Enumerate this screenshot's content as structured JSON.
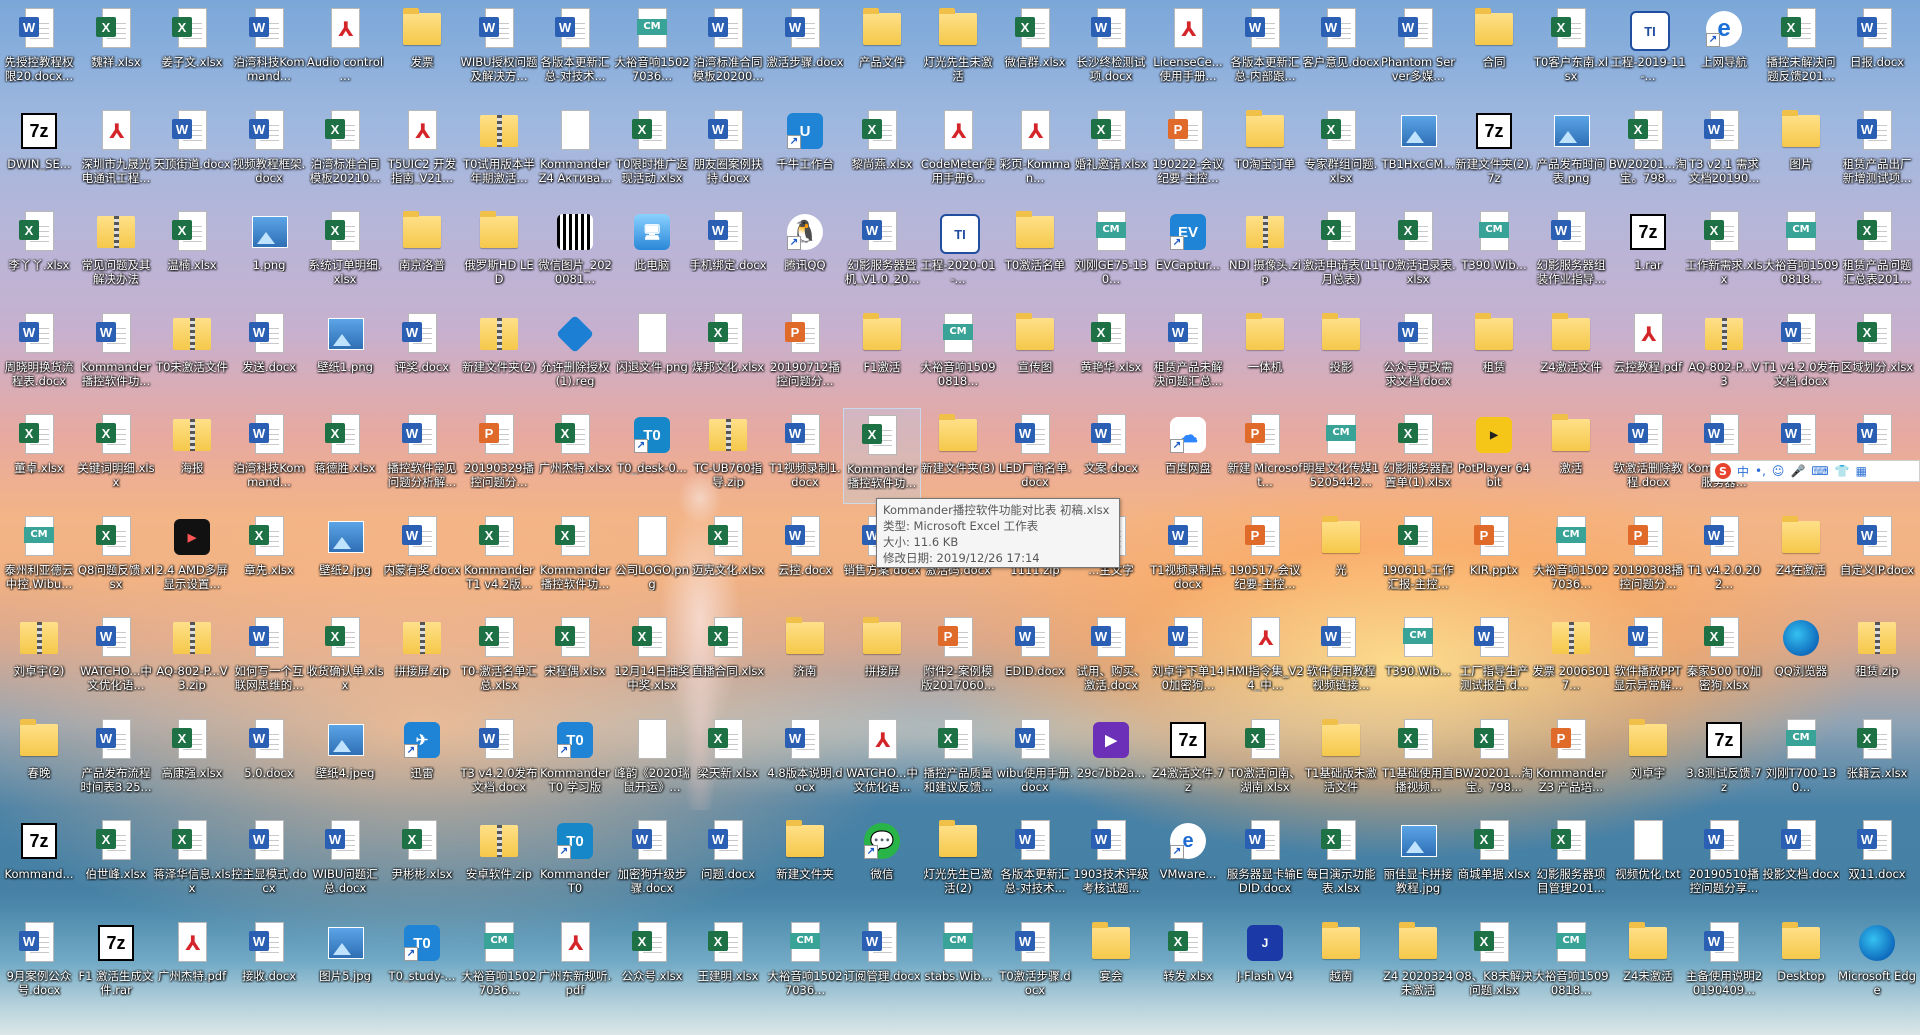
{
  "desktop": {
    "columns": 25,
    "selected_label": "Kommander播控软件功能对比表 初稿.xlsx",
    "icons": [
      {
        "label": "先授控教程权限20.docx...",
        "type": "word"
      },
      {
        "label": "魏祥.xlsx",
        "type": "excel"
      },
      {
        "label": "姜子文.xlsx",
        "type": "excel"
      },
      {
        "label": "泊湾科技Kommand...",
        "type": "word"
      },
      {
        "label": "Audio control ...",
        "type": "pdf"
      },
      {
        "label": "发票",
        "type": "folder"
      },
      {
        "label": "WIBU授权问题及解决方...",
        "type": "word"
      },
      {
        "label": "各版本更新汇总-对技术...",
        "type": "word"
      },
      {
        "label": "大裕音响15027036...",
        "type": "cm"
      },
      {
        "label": "泊湾标准合同模板20200...",
        "type": "word"
      },
      {
        "label": "激活步骤.docx",
        "type": "word"
      },
      {
        "label": "产品文件",
        "type": "folder"
      },
      {
        "label": "灯光先生未激活",
        "type": "folder"
      },
      {
        "label": "微信群.xlsx",
        "type": "excel"
      },
      {
        "label": "长沙终检测试项.docx",
        "type": "word"
      },
      {
        "label": "LicenseCe...使用手册...",
        "type": "pdf"
      },
      {
        "label": "各版本更新汇总-内部跟...",
        "type": "word"
      },
      {
        "label": "客户意见.docx",
        "type": "word"
      },
      {
        "label": "Phantom Server多媒...",
        "type": "word"
      },
      {
        "label": "合同",
        "type": "folder"
      },
      {
        "label": "T0客户东南.xlsx",
        "type": "excel"
      },
      {
        "label": "工程-2019-11-...",
        "type": "ti"
      },
      {
        "label": "上网导航",
        "type": "ie"
      },
      {
        "label": "播控未解决问题反馈201...",
        "type": "excel"
      },
      {
        "label": "日报.docx",
        "type": "word"
      },
      {
        "label": "DWIN_SE...",
        "type": "7z"
      },
      {
        "label": "深圳市九晟光电通讯工程...",
        "type": "pdf"
      },
      {
        "label": "天顶街道.docx",
        "type": "word"
      },
      {
        "label": "视频教程框架.docx",
        "type": "word"
      },
      {
        "label": "泊湾标准合同模板20210...",
        "type": "excel"
      },
      {
        "label": "T5UIC2 开发指南_V21...",
        "type": "pdf"
      },
      {
        "label": "T0试用版本半年期激活...",
        "type": "zip"
      },
      {
        "label": "Kommander Z4 Активa...",
        "type": "blank"
      },
      {
        "label": "T0限时推广返现活动.xlsx",
        "type": "excel"
      },
      {
        "label": "朋友圈案例扶持.docx",
        "type": "word"
      },
      {
        "label": "千牛工作台",
        "type": "app-blue",
        "glyph": "U"
      },
      {
        "label": "黎尚燕.xlsx",
        "type": "excel"
      },
      {
        "label": "CodeMeter使用手册6...",
        "type": "pdf"
      },
      {
        "label": "彩页-Komman...",
        "type": "pdf"
      },
      {
        "label": "婚礼邀请.xlsx",
        "type": "excel"
      },
      {
        "label": "190222-会议纪要-主控...",
        "type": "wps"
      },
      {
        "label": "T0淘宝订单",
        "type": "folder"
      },
      {
        "label": "专家群组问题.xlsx",
        "type": "excel"
      },
      {
        "label": "TB1HxcCM...",
        "type": "img"
      },
      {
        "label": "新建文件夹(2).7z",
        "type": "7z"
      },
      {
        "label": "产品发布时间表.png",
        "type": "img"
      },
      {
        "label": "BW20201...淘宝。798...",
        "type": "excel"
      },
      {
        "label": "T3 v2.1 需求文档20190...",
        "type": "word"
      },
      {
        "label": "图片",
        "type": "folder"
      },
      {
        "label": "租赁产品出厂新增测试项...",
        "type": "word"
      },
      {
        "label": "李丫丫.xlsx",
        "type": "excel"
      },
      {
        "label": "常见问题及其解决办法",
        "type": "zip"
      },
      {
        "label": "温楠.xlsx",
        "type": "excel"
      },
      {
        "label": "1.png",
        "type": "img"
      },
      {
        "label": "系统订单明细.xlsx",
        "type": "excel"
      },
      {
        "label": "南京洛普",
        "type": "folder"
      },
      {
        "label": "俄罗斯HD LED",
        "type": "folder"
      },
      {
        "label": "微信图片_2020081...",
        "type": "qr"
      },
      {
        "label": "此电脑",
        "type": "pc"
      },
      {
        "label": "手机绑定.docx",
        "type": "word"
      },
      {
        "label": "腾讯QQ",
        "type": "qq"
      },
      {
        "label": "幻影服务器暨机_V1.0_20...",
        "type": "word"
      },
      {
        "label": "工程-2020-01-...",
        "type": "ti"
      },
      {
        "label": "T0激活名单",
        "type": "folder"
      },
      {
        "label": "刘刚GE75-130...",
        "type": "cm"
      },
      {
        "label": "EVCaptur...",
        "type": "app-blue",
        "glyph": "EV"
      },
      {
        "label": "NDI 摄像头.zip",
        "type": "zip"
      },
      {
        "label": "激活申请表(11月总表)",
        "type": "excel"
      },
      {
        "label": "T0激活记录表.xlsx",
        "type": "excel"
      },
      {
        "label": "T390.Wib...",
        "type": "cm"
      },
      {
        "label": "幻影服务器组装作业指导...",
        "type": "word"
      },
      {
        "label": "1.rar",
        "type": "7z"
      },
      {
        "label": "工作新需求.xlsx",
        "type": "excel"
      },
      {
        "label": "大裕音响15090818...",
        "type": "cm"
      },
      {
        "label": "租赁产品问题汇总表201...",
        "type": "excel"
      },
      {
        "label": "周晓明换货流程表.docx",
        "type": "word"
      },
      {
        "label": "Kommander 播控软件功...",
        "type": "word"
      },
      {
        "label": "T0未激活文件",
        "type": "zip"
      },
      {
        "label": "发送.docx",
        "type": "word"
      },
      {
        "label": "壁纸1.png",
        "type": "img"
      },
      {
        "label": "评奖.docx",
        "type": "word"
      },
      {
        "label": "新建文件夹(2)",
        "type": "zip"
      },
      {
        "label": "允许删除授权(1).reg",
        "type": "reg"
      },
      {
        "label": "闪退文件.png",
        "type": "blank"
      },
      {
        "label": "煤邦文化.xlsx",
        "type": "excel"
      },
      {
        "label": "20190712播控问题分...",
        "type": "wps"
      },
      {
        "label": "F1激活",
        "type": "folder"
      },
      {
        "label": "大裕音响15090818...",
        "type": "cm"
      },
      {
        "label": "宣传图",
        "type": "folder"
      },
      {
        "label": "黄艳华.xlsx",
        "type": "excel"
      },
      {
        "label": "租赁产品未解决问题汇总...",
        "type": "word"
      },
      {
        "label": "一体机",
        "type": "folder"
      },
      {
        "label": "投影",
        "type": "folder"
      },
      {
        "label": "公众号更改需求文档.docx",
        "type": "word"
      },
      {
        "label": "租赁",
        "type": "folder"
      },
      {
        "label": "Z4激活文件",
        "type": "folder"
      },
      {
        "label": "云控教程.pdf",
        "type": "pdf"
      },
      {
        "label": "AQ-802-P...V3",
        "type": "zip"
      },
      {
        "label": "T1 v4.2.0发布文档.docx",
        "type": "word"
      },
      {
        "label": "区域划分.xlsx",
        "type": "excel"
      },
      {
        "label": "董卓.xlsx",
        "type": "excel"
      },
      {
        "label": "关键词明细.xlsx",
        "type": "excel"
      },
      {
        "label": "海报",
        "type": "zip"
      },
      {
        "label": "泊湾科技Kommand...",
        "type": "word"
      },
      {
        "label": "蒋德胜.xlsx",
        "type": "excel"
      },
      {
        "label": "播控软件常见问题分析解...",
        "type": "word"
      },
      {
        "label": "20190329播控问题分...",
        "type": "wps"
      },
      {
        "label": "广州杰特.xlsx",
        "type": "excel"
      },
      {
        "label": "T0_desk-0...",
        "type": "app-teal",
        "glyph": "T0"
      },
      {
        "label": "TC-UB760指导.zip",
        "type": "zip"
      },
      {
        "label": "T1视频录制1.docx",
        "type": "word"
      },
      {
        "label": "Kommander播控软件功...",
        "type": "excel",
        "selected": true
      },
      {
        "label": "新建文件夹(3)",
        "type": "folder"
      },
      {
        "label": "LED厂商名单.docx",
        "type": "word"
      },
      {
        "label": "文案.docx",
        "type": "word"
      },
      {
        "label": "百度网盘",
        "type": "baidu"
      },
      {
        "label": "新建 Microsoft...",
        "type": "wps"
      },
      {
        "label": "明星文化传媒15205442...",
        "type": "cm"
      },
      {
        "label": "幻影服务器配置单(1).xlsx",
        "type": "excel"
      },
      {
        "label": "PotPlayer 64 bit",
        "type": "pot"
      },
      {
        "label": "激活",
        "type": "folder"
      },
      {
        "label": "软激活删除教程.docx",
        "type": "word"
      },
      {
        "label": "Komma... Z4服务器...",
        "type": "word"
      },
      {
        "label": ".docx",
        "type": "word"
      },
      {
        "label": ".docx",
        "type": "word"
      },
      {
        "label": "泰州利亚德云中控.Wibu...",
        "type": "cm"
      },
      {
        "label": "Q8问题反馈.xlsx",
        "type": "excel"
      },
      {
        "label": "2.4 AMD多屏显示设置...",
        "type": "black"
      },
      {
        "label": "章先.xlsx",
        "type": "excel"
      },
      {
        "label": "壁纸2.jpg",
        "type": "img"
      },
      {
        "label": "内蒙有奖.docx",
        "type": "word"
      },
      {
        "label": "Kommander T1 v4.2版...",
        "type": "excel"
      },
      {
        "label": "Kommander 播控软件功...",
        "type": "excel"
      },
      {
        "label": "公司LOGO.png",
        "type": "blank"
      },
      {
        "label": "迈克文化.xlsx",
        "type": "excel"
      },
      {
        "label": "云控.docx",
        "type": "word"
      },
      {
        "label": "销售方案.docx",
        "type": "word"
      },
      {
        "label": "激活码.docx",
        "type": "word"
      },
      {
        "label": "1111.zip",
        "type": "zip"
      },
      {
        "label": "...主文字",
        "type": "word"
      },
      {
        "label": "T1视频录制点.docx",
        "type": "word"
      },
      {
        "label": "190517-会议纪要-主控...",
        "type": "wps"
      },
      {
        "label": "光",
        "type": "folder"
      },
      {
        "label": "190611-工作汇报-主控...",
        "type": "excel"
      },
      {
        "label": "KIR.pptx",
        "type": "wps"
      },
      {
        "label": "大裕音响15027036...",
        "type": "cm"
      },
      {
        "label": "20190308播控问题分...",
        "type": "wps"
      },
      {
        "label": "T1 v4.2.0.202...",
        "type": "word"
      },
      {
        "label": "Z4在激活",
        "type": "folder"
      },
      {
        "label": "自定义IP.docx",
        "type": "word"
      },
      {
        "label": "刘卓宇(2)",
        "type": "zip"
      },
      {
        "label": "WATCHO...中文优化语...",
        "type": "word"
      },
      {
        "label": "AQ-802-P...V3.zip",
        "type": "zip"
      },
      {
        "label": "如何写一个互联网思维的...",
        "type": "word"
      },
      {
        "label": "收货确认单.xlsx",
        "type": "excel"
      },
      {
        "label": "拼接屏.zip",
        "type": "zip"
      },
      {
        "label": "T0-激活名单汇总.xlsx",
        "type": "excel"
      },
      {
        "label": "宋程偶.xlsx",
        "type": "excel"
      },
      {
        "label": "12月14日抽奖中奖.xlsx",
        "type": "excel"
      },
      {
        "label": "直播合同.xlsx",
        "type": "excel"
      },
      {
        "label": "济南",
        "type": "folder"
      },
      {
        "label": "拼接屏",
        "type": "folder"
      },
      {
        "label": "附件2-案例模版2017060...",
        "type": "wps"
      },
      {
        "label": "EDID.docx",
        "type": "word"
      },
      {
        "label": "试用、购买、激活.docx",
        "type": "word"
      },
      {
        "label": "刘卓宇下单140加密狗...",
        "type": "word"
      },
      {
        "label": "HMI指令集_V24_中...",
        "type": "pdf"
      },
      {
        "label": "软件使用教程视频链接...",
        "type": "word"
      },
      {
        "label": "T390.Wib...",
        "type": "cm"
      },
      {
        "label": "工厂指导生产测试报告.d...",
        "type": "word"
      },
      {
        "label": "发票 20063017...",
        "type": "zip"
      },
      {
        "label": "软件播放PPT显示异常解...",
        "type": "word"
      },
      {
        "label": "秦家500 T0加密狗.xlsx",
        "type": "excel"
      },
      {
        "label": "QQ浏览器",
        "type": "edge"
      },
      {
        "label": "租赁.zip",
        "type": "zip"
      },
      {
        "label": "春晚",
        "type": "folder"
      },
      {
        "label": "产品发布流程时间表3.25...",
        "type": "word"
      },
      {
        "label": "高康强.xlsx",
        "type": "excel"
      },
      {
        "label": "5.0.docx",
        "type": "word"
      },
      {
        "label": "壁纸4.jpeg",
        "type": "img"
      },
      {
        "label": "迅雷",
        "type": "app-blue",
        "glyph": "✈"
      },
      {
        "label": "T3 v4.2.0发布文档.docx",
        "type": "word"
      },
      {
        "label": "Kommander T0 学习版",
        "type": "app-blue",
        "glyph": "T0"
      },
      {
        "label": "峰韵《2020瑞鼠开运》...",
        "type": "blank"
      },
      {
        "label": "梁天新.xlsx",
        "type": "excel"
      },
      {
        "label": "4.8版本说明.docx",
        "type": "word"
      },
      {
        "label": "WATCHO...中文优化语...",
        "type": "pdf"
      },
      {
        "label": "播控产品质量和建议反馈...",
        "type": "excel"
      },
      {
        "label": "wibu使用手册.docx",
        "type": "word"
      },
      {
        "label": "29c7bb2a...",
        "type": "mp4"
      },
      {
        "label": "Z4激活文件.7z",
        "type": "7z"
      },
      {
        "label": "T0激活问南、湖南.xlsx",
        "type": "excel"
      },
      {
        "label": "T1基础版未激活文件",
        "type": "folder"
      },
      {
        "label": "T1基础使用直播视频...",
        "type": "excel"
      },
      {
        "label": "BW20201...淘宝。798...",
        "type": "excel"
      },
      {
        "label": "Kommander Z3 产品培...",
        "type": "wps"
      },
      {
        "label": "刘卓宇",
        "type": "folder"
      },
      {
        "label": "3.8测试反馈.7z",
        "type": "7z"
      },
      {
        "label": "刘刚T700-130...",
        "type": "cm"
      },
      {
        "label": "张籍云.xlsx",
        "type": "excel"
      },
      {
        "label": "Kommand...",
        "type": "7z"
      },
      {
        "label": "伯世峰.xlsx",
        "type": "excel"
      },
      {
        "label": "蒋泽华信息.xlsx",
        "type": "excel"
      },
      {
        "label": "控主显模式.docx",
        "type": "word"
      },
      {
        "label": "WIBU问题汇总.docx",
        "type": "word"
      },
      {
        "label": "尹彬彬.xlsx",
        "type": "excel"
      },
      {
        "label": "安卓软件.zip",
        "type": "zip"
      },
      {
        "label": "Kommander T0",
        "type": "app-teal",
        "glyph": "T0"
      },
      {
        "label": "加密狗升级步骤.docx",
        "type": "word"
      },
      {
        "label": "问题.docx",
        "type": "word"
      },
      {
        "label": "新建文件夹",
        "type": "folder"
      },
      {
        "label": "微信",
        "type": "green"
      },
      {
        "label": "灯光先生已激活(2)",
        "type": "folder"
      },
      {
        "label": "各版本更新汇总-对技术...",
        "type": "word"
      },
      {
        "label": "1903技术评级考核试题...",
        "type": "word"
      },
      {
        "label": "VMware...",
        "type": "vm"
      },
      {
        "label": "服务器显卡输EDID.docx",
        "type": "word"
      },
      {
        "label": "每日演示功能表.xlsx",
        "type": "excel"
      },
      {
        "label": "丽佳显卡拼接教程.jpg",
        "type": "img"
      },
      {
        "label": "商城单据.xlsx",
        "type": "excel"
      },
      {
        "label": "幻影服务器项目管理201...",
        "type": "excel"
      },
      {
        "label": "视频优化.txt",
        "type": "blank"
      },
      {
        "label": "20190510播控问题分享...",
        "type": "word"
      },
      {
        "label": "投影文档.docx",
        "type": "word"
      },
      {
        "label": "双11.docx",
        "type": "word"
      },
      {
        "label": "9月案例公众号.docx",
        "type": "word"
      },
      {
        "label": "F1 激活生成文件.rar",
        "type": "7z"
      },
      {
        "label": "广州杰特.pdf",
        "type": "pdf"
      },
      {
        "label": "接收.docx",
        "type": "word"
      },
      {
        "label": "图片5.jpg",
        "type": "img"
      },
      {
        "label": "T0_study-...",
        "type": "app-blue",
        "glyph": "T0"
      },
      {
        "label": "大裕音响15027036...",
        "type": "cm"
      },
      {
        "label": "广州东新规听.pdf",
        "type": "pdf"
      },
      {
        "label": "公众号.xlsx",
        "type": "excel"
      },
      {
        "label": "王建明.xlsx",
        "type": "excel"
      },
      {
        "label": "大裕音响15027036...",
        "type": "cm"
      },
      {
        "label": "订阅管理.docx",
        "type": "word"
      },
      {
        "label": "stabs.Wib...",
        "type": "cm"
      },
      {
        "label": "T0激活步骤.docx",
        "type": "word"
      },
      {
        "label": "宴会",
        "type": "folder"
      },
      {
        "label": "转发.xlsx",
        "type": "excel"
      },
      {
        "label": "J-Flash V4",
        "type": "flash"
      },
      {
        "label": "越南",
        "type": "folder"
      },
      {
        "label": "Z4 2020324未激活",
        "type": "folder"
      },
      {
        "label": "Q8、K8未解决问题.xlsx",
        "type": "excel"
      },
      {
        "label": "大裕音响15090818...",
        "type": "cm"
      },
      {
        "label": "Z4未激活",
        "type": "folder"
      },
      {
        "label": "主备使用说明20190409...",
        "type": "word"
      },
      {
        "label": "Desktop",
        "type": "folder"
      },
      {
        "label": "Microsoft Edge",
        "type": "edge"
      }
    ]
  },
  "tooltip": {
    "line1": "Kommander播控软件功能对比表 初稿.xlsx",
    "line2": "类型: Microsoft Excel 工作表",
    "line3": "大小: 11.6 KB",
    "line4": "修改日期: 2019/12/26 17:14"
  },
  "ime": {
    "logo": "S",
    "lang": "中",
    "punct": "•,",
    "emoji": "☺",
    "mic": "🎤",
    "kbd": "⌨",
    "skin": "👕",
    "tools": "▦"
  },
  "colors": {
    "word": "#2b5fb4",
    "excel": "#1e7145",
    "pdf": "#d4262a",
    "folder": "#f5c84a"
  }
}
